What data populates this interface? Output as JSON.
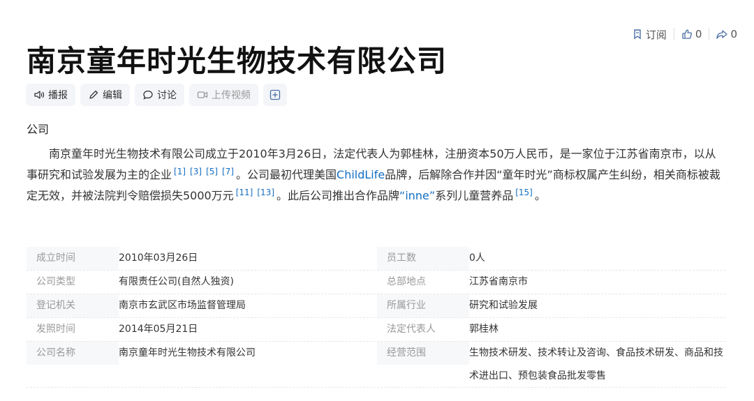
{
  "header": {
    "subscribe_label": "订阅",
    "like_count": "0",
    "share_count": "0"
  },
  "page": {
    "title": "南京童年时光生物技术有限公司",
    "category": "公司"
  },
  "toolbar": {
    "broadcast_label": "播报",
    "edit_label": "编辑",
    "discuss_label": "讨论",
    "upload_video_label": "上传视频"
  },
  "summary": {
    "part1": "南京童年时光生物技术有限公司成立于2010年3月26日，法定代表人为郭桂林，注册资本50万人民币，是一家位于江苏省南京市，以从事研究和试验发展为主的企业",
    "refs1": [
      "[1]",
      "[3]",
      "[5]",
      "[7]"
    ],
    "part2": "。公司最初代理美国",
    "link1": "ChildLife",
    "part3": "品牌，后解除合作并因“童年时光”商标权属产生纠纷，相关商标被裁定无效，并被法院判令赔偿损失5000万元",
    "refs2": [
      "[11]",
      "[13]"
    ],
    "part4": "。此后公司推出合作品牌",
    "link2": "“inne”",
    "part5": "系列儿童营养品",
    "refs3": [
      "[15]"
    ],
    "part6": "。"
  },
  "basic_info": {
    "left": [
      {
        "key": "成立时间",
        "value": "2010年03月26日"
      },
      {
        "key": "公司类型",
        "value": "有限责任公司(自然人独资)"
      },
      {
        "key": "登记机关",
        "value": "南京市玄武区市场监督管理局"
      },
      {
        "key": "发照时间",
        "value": "2014年05月21日"
      },
      {
        "key": "公司名称",
        "value": "南京童年时光生物技术有限公司"
      }
    ],
    "right": [
      {
        "key": "员工数",
        "value": "0人"
      },
      {
        "key": "总部地点",
        "value": "江苏省南京市"
      },
      {
        "key": "所属行业",
        "value": "研究和试验发展"
      },
      {
        "key": "法定代表人",
        "value": "郭桂林"
      },
      {
        "key": "经营范围",
        "value": "生物技术研发、技术转让及咨询、食品技术研发、商品和技术进出口、预包装食品批发零售"
      }
    ]
  }
}
